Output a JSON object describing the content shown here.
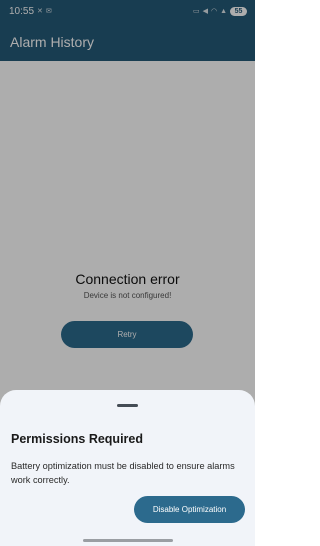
{
  "status_bar": {
    "time": "10:55",
    "left_icons": [
      "notification-icon",
      "message-icon"
    ],
    "right_icons": [
      "vibrate-icon",
      "mute-icon",
      "wifi-icon",
      "signal-icon"
    ],
    "battery": "55"
  },
  "app_bar": {
    "title": "Alarm History"
  },
  "main": {
    "error_title": "Connection error",
    "error_subtitle": "Device is not configured!",
    "retry_label": "Retry"
  },
  "sheet": {
    "title": "Permissions Required",
    "body": "Battery optimization must be disabled to ensure alarms work correctly.",
    "action_label": "Disable Optimization"
  },
  "colors": {
    "primary": "#245a78",
    "button": "#2c6a8d",
    "sheet_background": "#f1f4f9"
  }
}
